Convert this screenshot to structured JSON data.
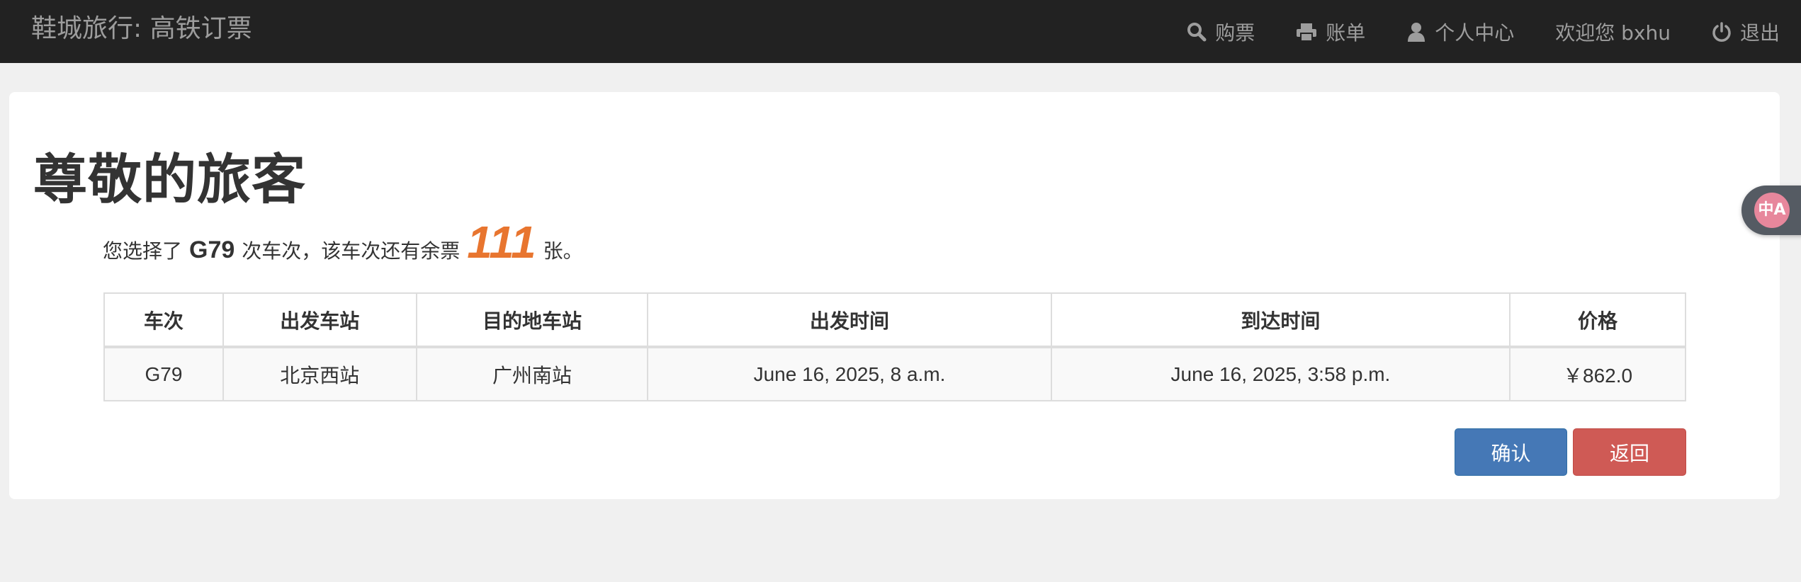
{
  "navbar": {
    "brand": "鞋城旅行: 高铁订票",
    "items": [
      {
        "icon": "search-icon",
        "label": "购票"
      },
      {
        "icon": "print-icon",
        "label": "账单"
      },
      {
        "icon": "user-icon",
        "label": "个人中心"
      },
      {
        "icon": null,
        "label": "欢迎您 bxhu"
      },
      {
        "icon": "power-icon",
        "label": "退出"
      }
    ]
  },
  "main": {
    "heading": "尊敬的旅客",
    "info_prefix": "您选择了",
    "train_no": "G79",
    "info_middle": "次车次，该车次还有余票",
    "remaining": "111",
    "info_suffix": "张。"
  },
  "table": {
    "headers": [
      "车次",
      "出发车站",
      "目的地车站",
      "出发时间",
      "到达时间",
      "价格"
    ],
    "rows": [
      [
        "G79",
        "北京西站",
        "广州南站",
        "June 16, 2025, 8 a.m.",
        "June 16, 2025, 3:58 p.m.",
        "￥862.0"
      ]
    ]
  },
  "buttons": {
    "confirm": "确认",
    "back": "返回"
  },
  "widget": {
    "label": "中A",
    "icon": "translate-icon"
  },
  "colors": {
    "navbar_bg": "#222222",
    "accent_count": "#e8752f",
    "confirm_bg": "#4578b6",
    "back_bg": "#cf5a55"
  }
}
